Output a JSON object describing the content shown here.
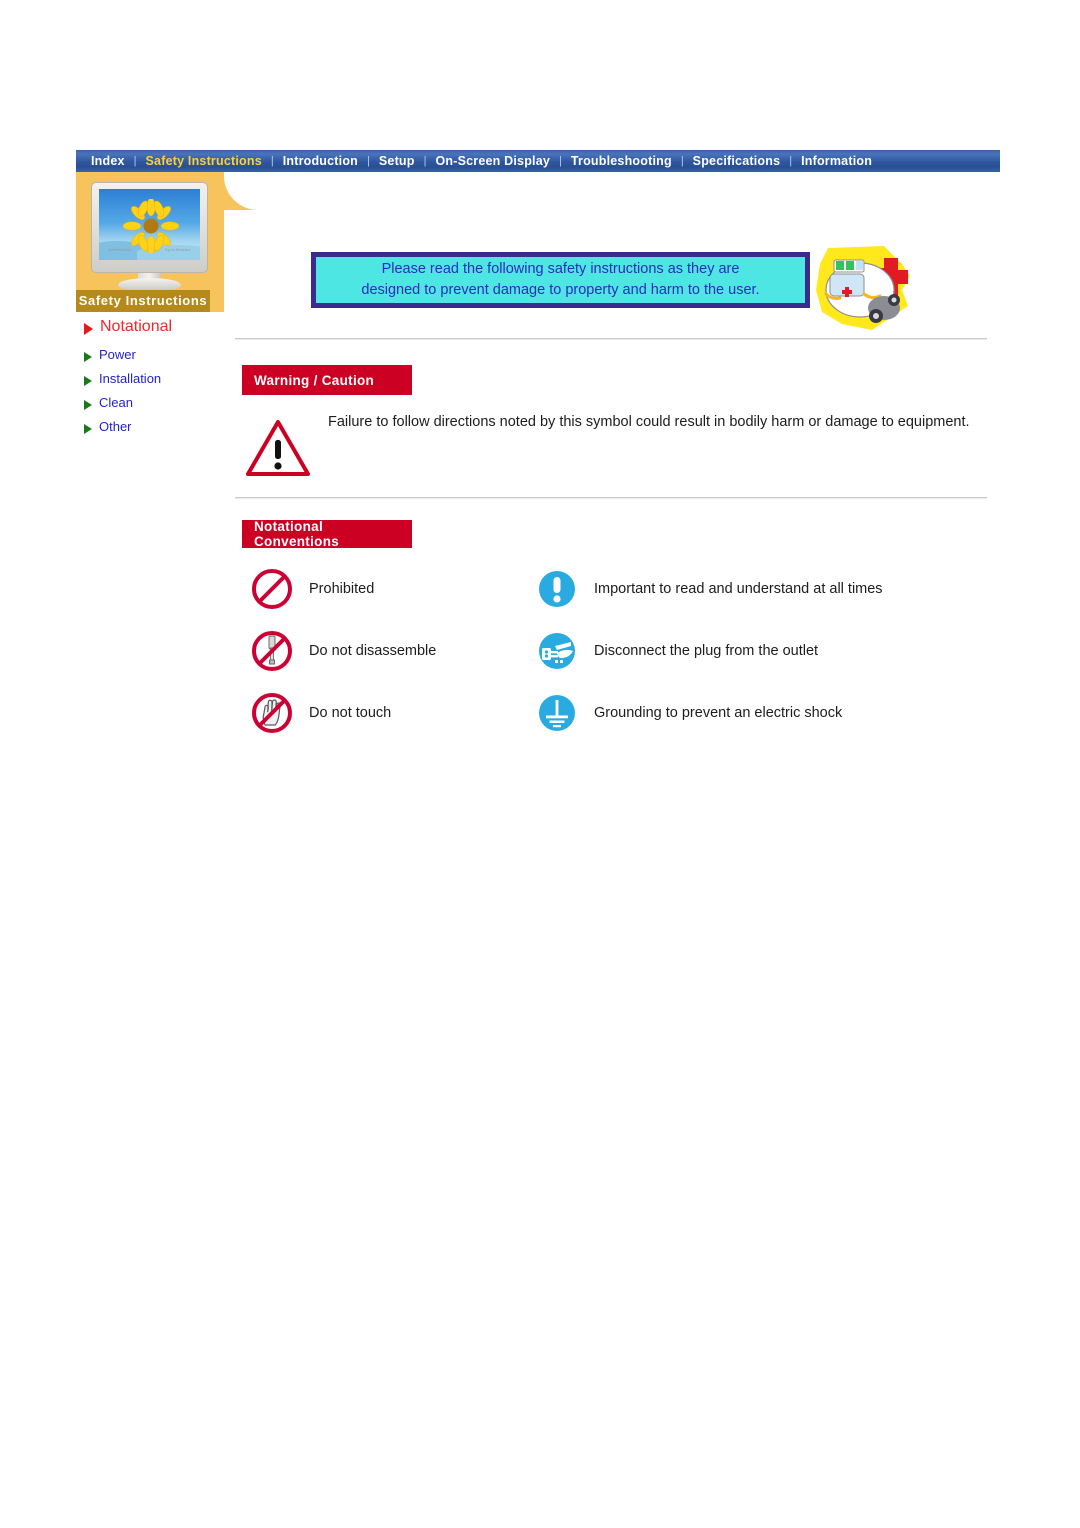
{
  "nav": {
    "items": [
      {
        "label": "Index",
        "active": false
      },
      {
        "label": "Safety Instructions",
        "active": true
      },
      {
        "label": "Introduction",
        "active": false
      },
      {
        "label": "Setup",
        "active": false
      },
      {
        "label": "On-Screen Display",
        "active": false
      },
      {
        "label": "Troubleshooting",
        "active": false
      },
      {
        "label": "Specifications",
        "active": false
      },
      {
        "label": "Information",
        "active": false
      }
    ],
    "separator": "|"
  },
  "sidebar": {
    "panel_label": "Safety Instructions",
    "monitor_brand_left": "SAMSUNG",
    "monitor_brand_right": "SyncMaster",
    "items": [
      {
        "label": "Notational",
        "current": true
      },
      {
        "label": "Power",
        "current": false
      },
      {
        "label": "Installation",
        "current": false
      },
      {
        "label": "Clean",
        "current": false
      },
      {
        "label": "Other",
        "current": false
      }
    ]
  },
  "banner": {
    "line1": "Please read the following safety instructions as they are",
    "line2": "designed to prevent damage to property and harm to the user.",
    "icon": "ambulance-icon"
  },
  "warning_section": {
    "tag": "Warning / Caution",
    "icon": "warning-triangle-icon",
    "text": "Failure to follow directions noted by this symbol could result in bodily harm or damage to equipment."
  },
  "notational_section": {
    "tag": "Notational Conventions",
    "rows": [
      {
        "left": {
          "icon": "prohibited-icon",
          "label": "Prohibited"
        },
        "right": {
          "icon": "important-icon",
          "label": "Important to read and understand at all times"
        }
      },
      {
        "left": {
          "icon": "do-not-disassemble-icon",
          "label": "Do not disassemble"
        },
        "right": {
          "icon": "disconnect-plug-icon",
          "label": "Disconnect the plug from the outlet"
        }
      },
      {
        "left": {
          "icon": "do-not-touch-icon",
          "label": "Do not touch"
        },
        "right": {
          "icon": "grounding-icon",
          "label": "Grounding to prevent an electric shock"
        }
      }
    ]
  },
  "colors": {
    "nav_bg": "#2f58a0",
    "nav_active_text": "#ffcf33",
    "sidebar_panel": "#f7c35c",
    "sidebar_label_bg": "#b5891a",
    "banner_border": "#3c2b8e",
    "banner_fill": "#4ee6e2",
    "banner_text": "#2b2bc4",
    "tag_bg": "#cc0022",
    "prohibition_red": "#cc0033",
    "info_blue": "#29abe2",
    "link_blue": "#2323c8",
    "current_red": "#f2262a"
  }
}
